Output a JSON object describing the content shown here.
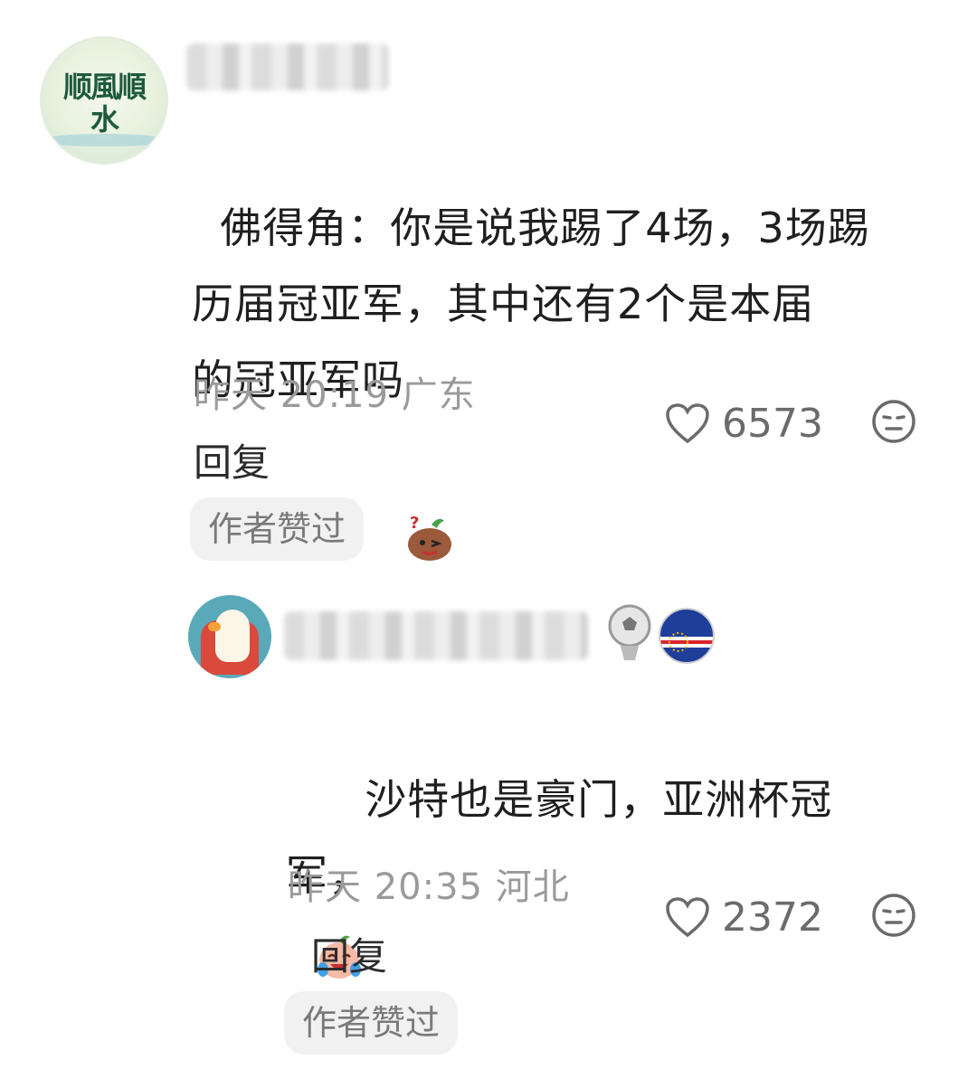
{
  "comments": [
    {
      "avatar_text": "顺風順水",
      "text": "佛得角：你是说我踢了4场，3场踢\n历届冠亚军，其中还有2个是本届\n的冠亚军吗",
      "emoji_icon": "thinking-potato-icon",
      "time": "昨天 20:19 广东",
      "reply_label": "回复",
      "like_count": "6573",
      "badge": "作者赞过"
    },
    {
      "emoji_icon": "crying-laughing-face-icon",
      "text": "沙特也是豪门，亚洲杯冠\n军，",
      "time": "昨天 20:35 河北",
      "reply_label": "回复",
      "like_count": "2372",
      "badge": "作者赞过",
      "user_badges": [
        "soccer-ball-badge-icon",
        "cape-verde-flag-icon"
      ]
    }
  ],
  "colors": {
    "text": "#1f1f1f",
    "meta": "#9a9a9a",
    "badge_bg": "#f1f1f1",
    "cape_verde_blue": "#1f3e9a",
    "cape_verde_red": "#d8252b"
  }
}
